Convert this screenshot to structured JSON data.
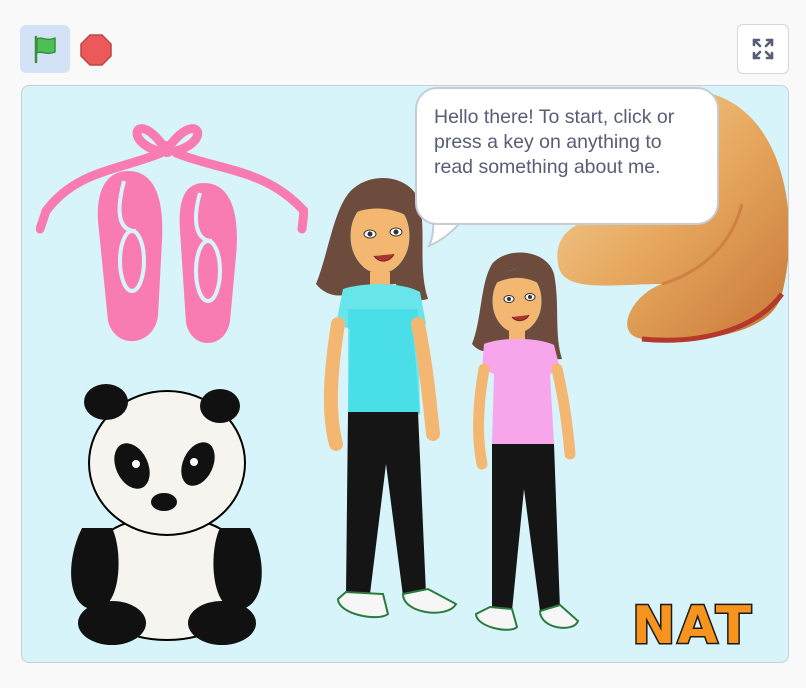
{
  "controls": {
    "green_flag_icon": "green-flag",
    "stop_icon": "stop-sign",
    "fullscreen_icon": "fullscreen-expand"
  },
  "stage": {
    "speech_bubble": {
      "text": "Hello there! To start, click or press a key on anything to read something about me."
    },
    "name_text": "NAT"
  },
  "colors": {
    "stage_background": "#d8f4fb",
    "flag_button_background": "#d4e2f6",
    "flag_green": "#4cbf56",
    "stop_red": "#ec5959",
    "bubble_text": "#575e75",
    "ballet_pink": "#f87cb2",
    "name_orange": "#f7941d"
  }
}
